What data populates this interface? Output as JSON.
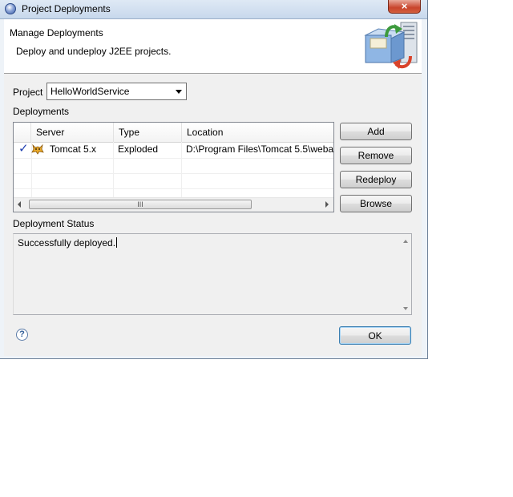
{
  "window": {
    "title": "Project Deployments",
    "close_label": "×"
  },
  "header": {
    "title": "Manage Deployments",
    "description": "Deploy and undeploy J2EE projects."
  },
  "project": {
    "label": "Project",
    "selected": "HelloWorldService"
  },
  "deployments": {
    "label": "Deployments",
    "columns": [
      "Server",
      "Type",
      "Location"
    ],
    "rows": [
      {
        "server": "Tomcat  5.x",
        "type": "Exploded",
        "location": "D:\\Program Files\\Tomcat 5.5\\weba"
      }
    ],
    "scroll_grip": "III"
  },
  "buttons": {
    "add": "Add",
    "remove": "Remove",
    "redeploy": "Redeploy",
    "browse": "Browse",
    "ok": "OK"
  },
  "status": {
    "label": "Deployment Status",
    "text": "Successfully deployed."
  },
  "help": {
    "glyph": "?"
  },
  "icons": {
    "app": "eclipse-icon",
    "check": "checkmark-icon",
    "server": "tomcat-icon",
    "help": "help-icon"
  }
}
